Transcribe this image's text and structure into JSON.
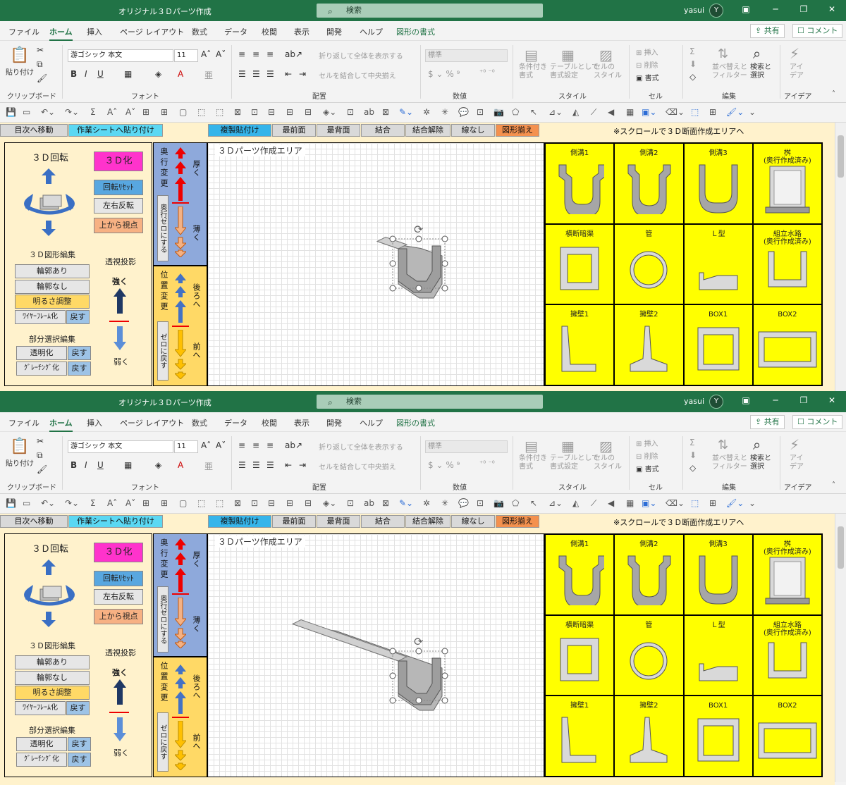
{
  "title": "オリジナル３Ｄパーツ作成",
  "search_placeholder": "検索",
  "user": "yasui",
  "avatar": "Y",
  "menu": [
    "ファイル",
    "ホーム",
    "挿入",
    "ページ レイアウト",
    "数式",
    "データ",
    "校閲",
    "表示",
    "開発",
    "ヘルプ",
    "図形の書式"
  ],
  "share": "共有",
  "comment": "コメント",
  "ribbon": {
    "paste": "貼り付け",
    "font_name": "游ゴシック 本文",
    "font_size": "11",
    "wrap_text": "折り返して全体を表示する",
    "merge_center": "セルを結合して中央揃え",
    "number_format": "標準",
    "cond_format": "条件付き\n書式",
    "table_format": "テーブルとして\n書式設定",
    "cell_style": "セルの\nスタイル",
    "insert": "挿入",
    "delete": "削除",
    "format": "書式",
    "sort_filter": "並べ替えと\nフィルター",
    "find_select": "検索と\n選択",
    "ideas": "アイ\nデア",
    "groups": [
      "クリップボード",
      "フォント",
      "配置",
      "数値",
      "スタイル",
      "セル",
      "編集",
      "アイデア"
    ]
  },
  "sheet": {
    "top_buttons": {
      "toc": "目次へ移動",
      "paste_to_work": "作業シートへ貼り付け",
      "dup_paste": "複製貼付け",
      "front": "最前面",
      "back": "最背面",
      "group": "結合",
      "ungroup": "結合解除",
      "no_line": "線なし",
      "align": "図形揃え"
    },
    "note": "※スクロールで３Ｄ断面作成エリアへ",
    "left": {
      "rot_title": "３Ｄ回転",
      "btn_3d": "３Ｄ化",
      "btn_reset": "回転ﾘｾｯﾄ",
      "btn_flip": "左右反転",
      "btn_top": "上から視点",
      "edit_title": "３Ｄ図形編集",
      "outline_on": "輪郭あり",
      "outline_off": "輪郭なし",
      "brightness": "明るさ調整",
      "wireframe": "ﾜｲﾔｰﾌﾚｰﾑ化",
      "back1": "戻す",
      "persp_title": "透視投影",
      "strong": "強く",
      "weak": "弱く",
      "partial_title": "部分選択編集",
      "transparent": "透明化",
      "back2": "戻す",
      "gradient": "ｸﾞﾚｰﾁﾝｸﾞ化",
      "back3": "戻す"
    },
    "depth": {
      "label": "奥行変更",
      "thick": "厚く",
      "thin": "薄く",
      "zero": "奥行ゼロにする"
    },
    "pos": {
      "label": "位置変更",
      "back": "後ろへ",
      "front": "前へ",
      "zero": "ゼロに戻す"
    },
    "area_title": "３Ｄパーツ作成エリア",
    "palette": [
      "側溝1",
      "側溝2",
      "側溝3",
      "桝\n(奥行作成済み)",
      "横断暗渠",
      "管",
      "Ｌ型",
      "組立水路\n(奥行作成済み)",
      "擁壁1",
      "擁壁2",
      "BOX1",
      "BOX2"
    ]
  },
  "colors": {
    "excel_green": "#217346",
    "sheet_bg": "#fff2cc",
    "palette_yellow": "#ffff00",
    "depth_panel": "#8ea9db",
    "pos_panel": "#ffd966"
  }
}
